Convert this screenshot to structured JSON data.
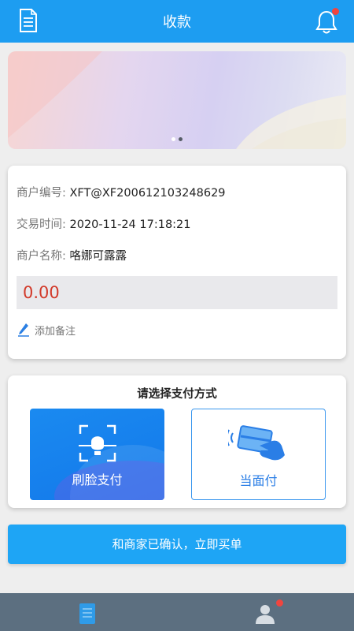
{
  "header": {
    "title": "收款",
    "left_icon": "document-icon",
    "right_icon": "bell-icon",
    "has_notification": true
  },
  "banner": {
    "page_count": 2,
    "active_page": 2
  },
  "merchant": {
    "number_label": "商户编号:",
    "number_value": "XFT@XF200612103248629",
    "time_label": "交易时间:",
    "time_value": "2020-11-24 17:18:21",
    "name_label": "商户名称:",
    "name_value": "咯娜可露露"
  },
  "amount": {
    "value": "0.00"
  },
  "note": {
    "label": "添加备注",
    "icon": "pencil-icon"
  },
  "payment": {
    "title": "请选择支付方式",
    "options": [
      {
        "label": "刷脸支付",
        "icon": "face-scan-icon",
        "selected": true
      },
      {
        "label": "当面付",
        "icon": "card-hand-icon",
        "selected": false
      }
    ]
  },
  "confirm_button": {
    "label": "和商家已确认，立即买单"
  },
  "tabbar": {
    "tabs": [
      {
        "icon": "receipt-icon",
        "active": true
      },
      {
        "icon": "user-icon",
        "has_notification": true
      }
    ]
  },
  "colors": {
    "primary": "#1d9df1",
    "amount": "#d23a2a",
    "badge": "#f0453f",
    "tabbar": "#5c6f80"
  }
}
